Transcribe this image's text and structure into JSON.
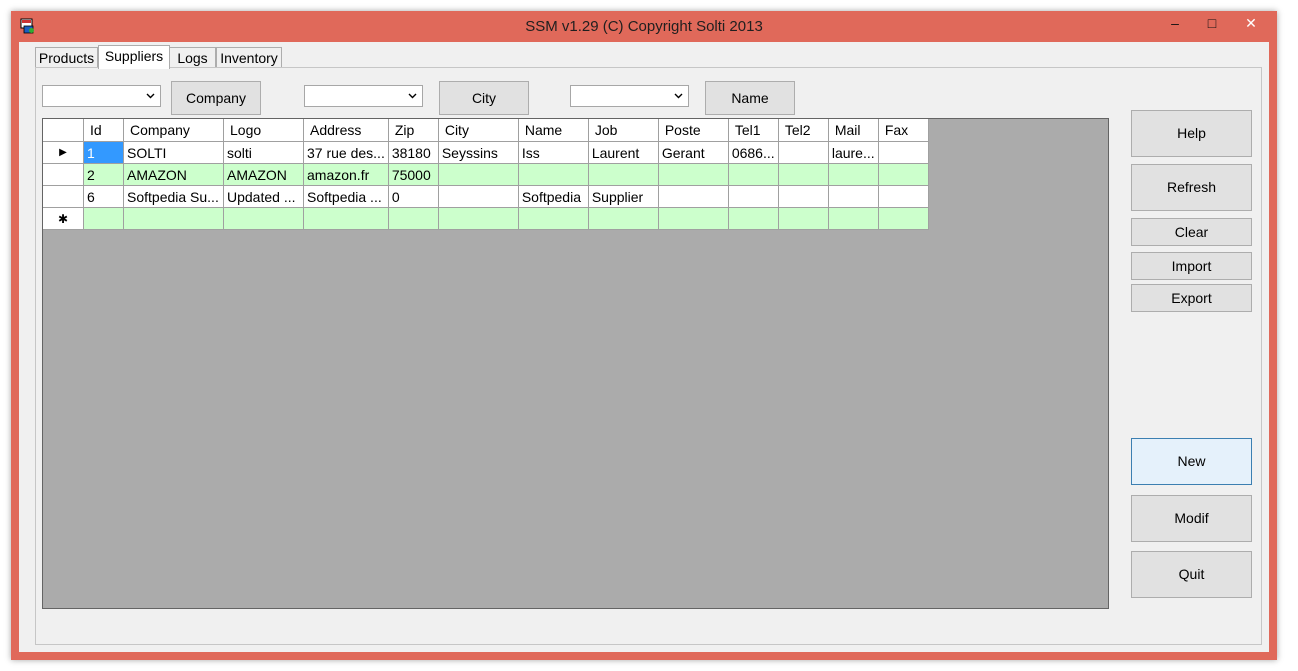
{
  "window": {
    "title": "SSM v1.29 (C) Copyright Solti 2013",
    "minimize": "–",
    "maximize": "□",
    "close": "✕"
  },
  "tabs": [
    {
      "label": "Products"
    },
    {
      "label": "Suppliers"
    },
    {
      "label": "Logs"
    },
    {
      "label": "Inventory"
    }
  ],
  "filters": {
    "company_combo": "",
    "company_button": "Company",
    "city_combo": "",
    "city_button": "City",
    "name_combo": "",
    "name_button": "Name"
  },
  "grid": {
    "columns": [
      "Id",
      "Company",
      "Logo",
      "Address",
      "Zip",
      "City",
      "Name",
      "Job",
      "Poste",
      "Tel1",
      "Tel2",
      "Mail",
      "Fax"
    ],
    "rows": [
      [
        "1",
        "SOLTI",
        "solti",
        "37 rue des...",
        "38180",
        "Seyssins",
        "Iss",
        "Laurent",
        "Gerant",
        "0686...",
        "",
        "laure...",
        ""
      ],
      [
        "2",
        "AMAZON",
        "AMAZON",
        "amazon.fr",
        "75000",
        "",
        "",
        "",
        "",
        "",
        "",
        "",
        ""
      ],
      [
        "6",
        "Softpedia Su...",
        "Updated ...",
        "Softpedia ...",
        "0",
        "",
        "Softpedia",
        "Supplier",
        "",
        "",
        "",
        "",
        ""
      ],
      [
        "",
        "",
        "",
        "",
        "",
        "",
        "",
        "",
        "",
        "",
        "",
        "",
        ""
      ]
    ],
    "current_row_marker": "▶",
    "new_row_marker": "✱"
  },
  "side_buttons": {
    "help": "Help",
    "refresh": "Refresh",
    "clear": "Clear",
    "import": "Import",
    "export": "Export",
    "new": "New",
    "modif": "Modif",
    "quit": "Quit"
  },
  "colors": {
    "frame": "#e0695a",
    "alt_row": "#ccffcc",
    "selection": "#3399ff",
    "grid_bg": "#ababab"
  }
}
